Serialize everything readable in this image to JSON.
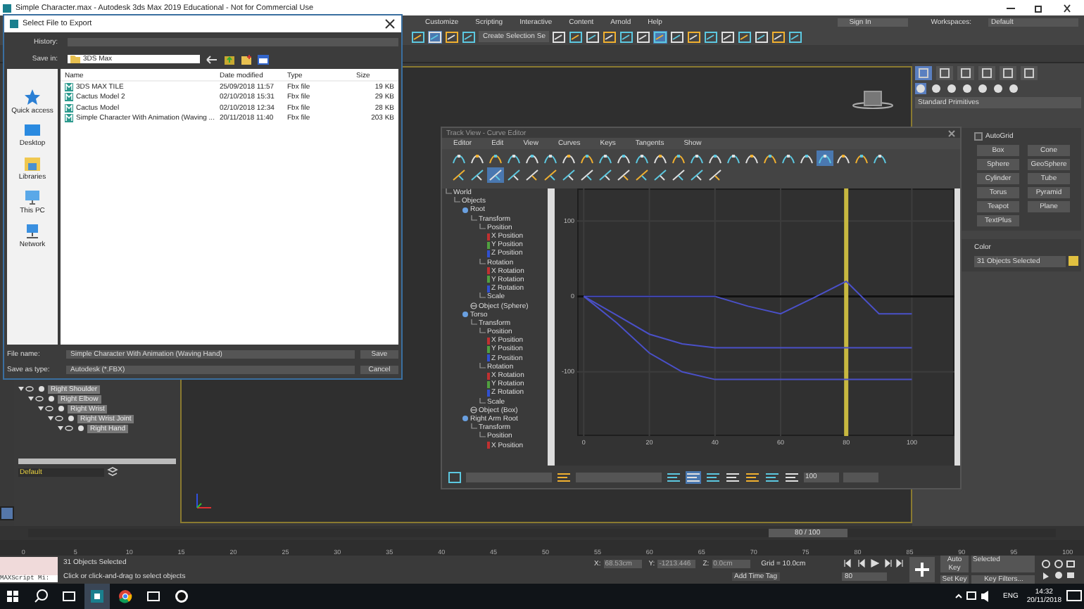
{
  "app_window": {
    "title": "Simple Character.max - Autodesk 3ds Max 2019 Educational - Not for Commercial Use"
  },
  "menu_bar": {
    "items": [
      "Customize",
      "Scripting",
      "Interactive",
      "Content",
      "Arnold",
      "Help"
    ],
    "sign_in": "Sign In",
    "workspaces_label": "Workspaces:",
    "workspace": "Default"
  },
  "main_toolbar": {
    "selection_set": "Create Selection Se",
    "tools": [
      {
        "selected": false
      },
      {
        "selected": true
      },
      {
        "selected": false
      },
      {
        "selected": false
      },
      {
        "selected": false
      },
      {
        "selected": false
      },
      {
        "selected": false
      },
      {
        "selected": false
      },
      {
        "selected": false
      },
      {
        "selected": false
      },
      {
        "selected": true
      },
      {
        "selected": false
      },
      {
        "selected": false
      },
      {
        "selected": false
      },
      {
        "selected": false
      },
      {
        "selected": false
      },
      {
        "selected": false
      },
      {
        "selected": false
      },
      {
        "selected": false
      }
    ]
  },
  "scene_explorer": {
    "tree": [
      {
        "label": "Right Shoulder",
        "children": [
          {
            "label": "Right Elbow",
            "children": [
              {
                "label": "Right Wrist",
                "children": [
                  {
                    "label": "Right Wrist Joint",
                    "children": [
                      {
                        "label": "Right Hand"
                      }
                    ]
                  }
                ]
              }
            ]
          }
        ]
      }
    ],
    "layer": "Default"
  },
  "command_panel": {
    "tabs": [
      {
        "selected": true
      },
      {
        "selected": false
      },
      {
        "selected": false
      },
      {
        "selected": false
      },
      {
        "selected": false
      },
      {
        "selected": false
      }
    ],
    "categories": [
      {
        "selected": true
      },
      {
        "selected": false
      },
      {
        "selected": false
      },
      {
        "selected": false
      },
      {
        "selected": false
      },
      {
        "selected": false
      },
      {
        "selected": false
      }
    ],
    "dropdown": "Standard Primitives",
    "autogrid": {
      "label": "AutoGrid",
      "checked": false
    },
    "object_buttons": [
      "Box",
      "Cone",
      "Sphere",
      "GeoSphere",
      "Cylinder",
      "Tube",
      "Torus",
      "Pyramid",
      "Teapot",
      "Plane",
      "TextPlus"
    ],
    "color_section": {
      "title": "Color",
      "name": "31 Objects Selected"
    }
  },
  "export_dialog": {
    "title": "Select File to Export",
    "history_label": "History:",
    "save_in_label": "Save in:",
    "save_in": "3DS Max",
    "places": [
      {
        "label": "Quick access",
        "kind": "quick"
      },
      {
        "label": "Desktop",
        "kind": "desktop"
      },
      {
        "label": "Libraries",
        "kind": "libraries"
      },
      {
        "label": "This PC",
        "kind": "pc"
      },
      {
        "label": "Network",
        "kind": "network"
      }
    ],
    "columns": [
      "Name",
      "Date modified",
      "Type",
      "Size"
    ],
    "rows": [
      [
        "3DS MAX TILE",
        "25/09/2018 11:57",
        "Fbx file",
        "19 KB"
      ],
      [
        "Cactus Model 2",
        "02/10/2018 15:31",
        "Fbx file",
        "29 KB"
      ],
      [
        "Cactus Model",
        "02/10/2018 12:34",
        "Fbx file",
        "28 KB"
      ],
      [
        "Simple Character With Animation (Waving ...",
        "20/11/2018 11:40",
        "Fbx file",
        "203 KB"
      ]
    ],
    "file_name_label": "File name:",
    "file_name": "Simple Character With Animation (Waving Hand)",
    "type_label": "Save as type:",
    "type": "Autodesk (*.FBX)",
    "buttons": [
      "Save",
      "Cancel"
    ]
  },
  "curve_editor": {
    "title": "Track View - Curve Editor",
    "menu": [
      "Editor",
      "Edit",
      "View",
      "Curves",
      "Keys",
      "Tangents",
      "Show"
    ],
    "toolbar_1": [
      {
        "selected": false
      },
      {
        "selected": false
      },
      {
        "selected": false
      },
      {
        "selected": false
      },
      {
        "selected": false
      },
      {
        "selected": false
      },
      {
        "selected": false
      },
      {
        "selected": false
      },
      {
        "selected": false
      },
      {
        "selected": false
      },
      {
        "selected": false
      },
      {
        "selected": false
      },
      {
        "selected": false
      },
      {
        "selected": false
      },
      {
        "selected": false
      },
      {
        "selected": false
      },
      {
        "selected": false
      },
      {
        "selected": false
      },
      {
        "selected": false
      },
      {
        "selected": false
      },
      {
        "selected": true
      },
      {
        "selected": false
      },
      {
        "selected": false
      },
      {
        "selected": false
      }
    ],
    "toolbar_2": [
      {
        "selected": false
      },
      {
        "selected": false
      },
      {
        "selected": true
      },
      {
        "selected": false
      },
      {
        "selected": false
      },
      {
        "selected": false
      },
      {
        "selected": false
      },
      {
        "selected": false
      },
      {
        "selected": false
      },
      {
        "selected": false
      },
      {
        "selected": false
      },
      {
        "selected": false
      },
      {
        "selected": false
      },
      {
        "selected": false
      },
      {
        "selected": false
      }
    ],
    "tree": [
      {
        "label": "World",
        "kind": "folder",
        "children": [
          {
            "label": "Objects",
            "kind": "folder",
            "children": [
              {
                "label": "Root",
                "kind": "object",
                "children": [
                  {
                    "label": "Transform",
                    "kind": "folder",
                    "children": [
                      {
                        "label": "Position",
                        "kind": "folder",
                        "children": [
                          {
                            "label": "X Position",
                            "kind": "track",
                            "color": "#c03030"
                          },
                          {
                            "label": "Y Position",
                            "kind": "track",
                            "color": "#50a040"
                          },
                          {
                            "label": "Z Position",
                            "kind": "track",
                            "color": "#3050d0"
                          }
                        ]
                      },
                      {
                        "label": "Rotation",
                        "kind": "folder",
                        "children": [
                          {
                            "label": "X Rotation",
                            "kind": "track",
                            "color": "#c03030"
                          },
                          {
                            "label": "Y Rotation",
                            "kind": "track",
                            "color": "#50a040"
                          },
                          {
                            "label": "Z Rotation",
                            "kind": "track",
                            "color": "#3050d0"
                          }
                        ]
                      },
                      {
                        "label": "Scale",
                        "kind": "folder"
                      }
                    ]
                  },
                  {
                    "label": "Object (Sphere)",
                    "kind": "modifier"
                  }
                ]
              },
              {
                "label": "Torso",
                "kind": "object",
                "children": [
                  {
                    "label": "Transform",
                    "kind": "folder",
                    "children": [
                      {
                        "label": "Position",
                        "kind": "folder",
                        "children": [
                          {
                            "label": "X Position",
                            "kind": "track",
                            "color": "#c03030"
                          },
                          {
                            "label": "Y Position",
                            "kind": "track",
                            "color": "#50a040"
                          },
                          {
                            "label": "Z Position",
                            "kind": "track",
                            "color": "#3050d0"
                          }
                        ]
                      },
                      {
                        "label": "Rotation",
                        "kind": "folder",
                        "children": [
                          {
                            "label": "X Rotation",
                            "kind": "track",
                            "color": "#c03030"
                          },
                          {
                            "label": "Y Rotation",
                            "kind": "track",
                            "color": "#50a040"
                          },
                          {
                            "label": "Z Rotation",
                            "kind": "track",
                            "color": "#3050d0"
                          }
                        ]
                      },
                      {
                        "label": "Scale",
                        "kind": "folder"
                      }
                    ]
                  },
                  {
                    "label": "Object (Box)",
                    "kind": "modifier"
                  }
                ]
              },
              {
                "label": "Right Arm Root",
                "kind": "object",
                "children": [
                  {
                    "label": "Transform",
                    "kind": "folder",
                    "children": [
                      {
                        "label": "Position",
                        "kind": "folder",
                        "children": [
                          {
                            "label": "X Position",
                            "kind": "track",
                            "color": "#c03030"
                          }
                        ]
                      }
                    ]
                  }
                ]
              }
            ]
          }
        ]
      }
    ],
    "chart_data": {
      "type": "line",
      "x": [
        0,
        10,
        20,
        30,
        40,
        50,
        60,
        70,
        80,
        90,
        100
      ],
      "series": [
        {
          "color": "#4a50c8",
          "values": [
            0,
            0,
            0,
            0,
            0,
            -13,
            -23,
            -2,
            20,
            -23,
            -23
          ]
        },
        {
          "color": "#4a50c8",
          "values": [
            0,
            -25,
            -50,
            -63,
            -68,
            -68,
            -68,
            -68,
            -68,
            -68,
            -68
          ]
        },
        {
          "color": "#4a50c8",
          "values": [
            0,
            -35,
            -75,
            -100,
            -110,
            -110,
            -110,
            -110,
            -110,
            -110,
            -110
          ]
        }
      ],
      "xlim": [
        -2,
        113
      ],
      "ylim": [
        -185,
        143
      ],
      "xticks": [
        {
          "value": 0,
          "label": "0"
        },
        {
          "value": 20,
          "label": "20"
        },
        {
          "value": 40,
          "label": "40"
        },
        {
          "value": 60,
          "label": "60"
        },
        {
          "value": 80,
          "label": "80"
        },
        {
          "value": 100,
          "label": "100"
        }
      ],
      "yticks": [
        {
          "value": -100,
          "label": "-100"
        },
        {
          "value": 0,
          "label": "0"
        },
        {
          "value": 100,
          "label": "100"
        }
      ],
      "grid": true,
      "ref_lines": [
        {
          "axis": "x",
          "value": 80
        }
      ]
    },
    "bottom_toolbar": [
      {
        "selected": false
      },
      {
        "selected": false
      },
      {
        "selected": true
      },
      {
        "selected": false
      },
      {
        "selected": false
      },
      {
        "selected": false
      },
      {
        "selected": false
      },
      {
        "selected": false
      }
    ],
    "bottom_field": "100"
  },
  "time_slider": {
    "label": "80 / 100",
    "level": 0.8
  },
  "trackbar": {
    "ticks": [
      "0",
      "5",
      "10",
      "15",
      "20",
      "25",
      "30",
      "35",
      "40",
      "45",
      "50",
      "55",
      "60",
      "65",
      "70",
      "75",
      "80",
      "85",
      "90",
      "95",
      "100"
    ]
  },
  "status_bar": {
    "maxscript": "MAXScript Mi:",
    "selection": "31 Objects Selected",
    "prompt": "Click or click-and-drag to select objects",
    "coords": [
      {
        "label": "X:",
        "value": "68.53cm"
      },
      {
        "label": "Y:",
        "value": "-1213.446"
      },
      {
        "label": "Z:",
        "value": "0.0cm"
      }
    ],
    "grid": "Grid = 10.0cm",
    "add_time_tag": "Add Time Tag",
    "frame": "80",
    "auto_key": "Auto Key",
    "key_mode": "Selected",
    "set_key": "Set Key",
    "key_filters": "Key Filters..."
  },
  "taskbar": {
    "apps": [
      {
        "kind": "max",
        "selected": true
      },
      {
        "kind": "chrome",
        "selected": false
      },
      {
        "kind": "app",
        "selected": false
      },
      {
        "kind": "unreal",
        "selected": false
      }
    ],
    "language": "ENG",
    "time": "14:32",
    "date": "20/11/2018"
  }
}
